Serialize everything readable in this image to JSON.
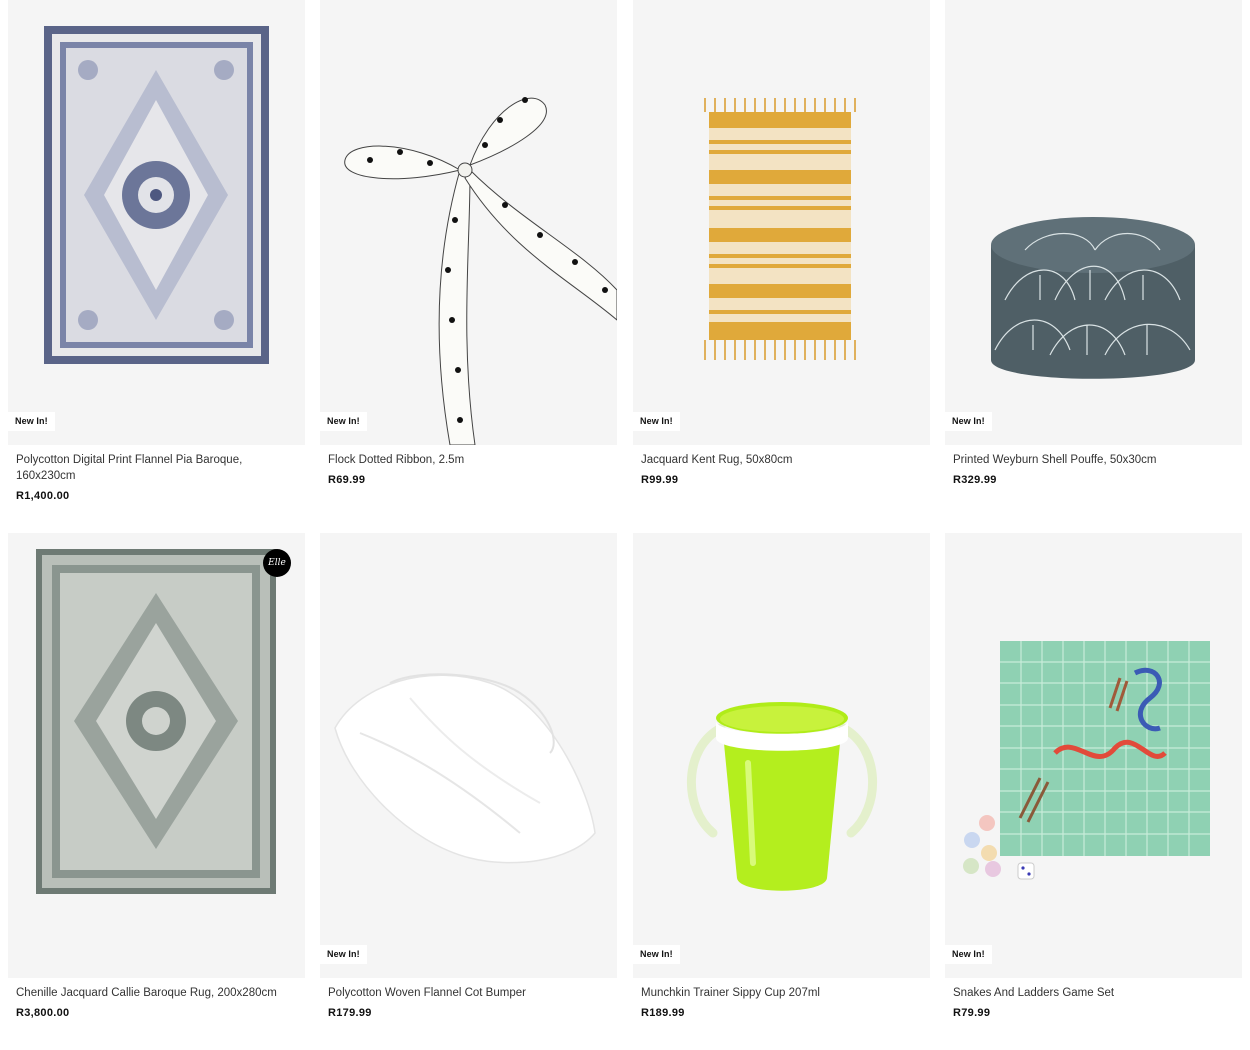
{
  "products": [
    {
      "title": "Polycotton Digital Print Flannel Pia Baroque, 160x230cm",
      "price": "R1,400.00",
      "badge": "New In!",
      "image": "blue-persian-rug"
    },
    {
      "title": "Flock Dotted Ribbon, 2.5m",
      "price": "R69.99",
      "badge": "New In!",
      "image": "dotted-ribbon-bow"
    },
    {
      "title": "Jacquard Kent Rug, 50x80cm",
      "price": "R99.99",
      "badge": "New In!",
      "image": "yellow-striped-rug"
    },
    {
      "title": "Printed Weyburn Shell Pouffe, 50x30cm",
      "price": "R329.99",
      "badge": "New In!",
      "image": "shell-pattern-pouffe"
    },
    {
      "title": "Chenille Jacquard Callie Baroque Rug, 200x280cm",
      "price": "R3,800.00",
      "badge": "",
      "image": "green-baroque-rug",
      "brand_mark": "Elle"
    },
    {
      "title": "Polycotton Woven Flannel Cot Bumper",
      "price": "R179.99",
      "badge": "New In!",
      "image": "white-cot-bumper"
    },
    {
      "title": "Munchkin Trainer Sippy Cup 207ml",
      "price": "R189.99",
      "badge": "New In!",
      "image": "green-sippy-cup"
    },
    {
      "title": "Snakes And Ladders Game Set",
      "price": "R79.99",
      "badge": "New In!",
      "image": "snakes-ladders-board"
    }
  ]
}
